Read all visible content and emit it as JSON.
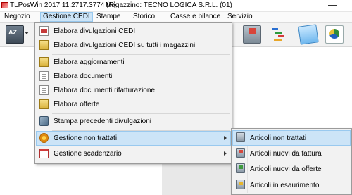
{
  "window": {
    "title": "TLPosWin 2017.11.2717.3774 (R)",
    "store": "Magazzino: TECNO LOGICA S.R.L. (01)"
  },
  "menubar": {
    "items": [
      "Negozio",
      "Gestione CEDI",
      "Stampe",
      "Storico",
      "Casse e bilance",
      "Servizio"
    ],
    "active_index": 1
  },
  "toolbar": {
    "az_label": "AZ"
  },
  "menu": {
    "items": [
      {
        "label": "Elabora divulgazioni CEDI",
        "icon": "document-red-icon"
      },
      {
        "label": "Elabora divulgazioni CEDI su tutti i magazzini",
        "icon": "document-yellow-icon"
      },
      {
        "label": "Elabora aggiornamenti",
        "icon": "document-yellow-icon"
      },
      {
        "label": "Elabora documenti",
        "icon": "document-icon"
      },
      {
        "label": "Elabora documenti rifatturazione",
        "icon": "document-icon"
      },
      {
        "label": "Elabora offerte",
        "icon": "document-yellow-icon"
      },
      {
        "label": "Stampa precedenti divulgazioni",
        "icon": "tool-icon"
      },
      {
        "label": "Gestione non trattati",
        "icon": "gear-icon",
        "has_submenu": true,
        "highlighted": true
      },
      {
        "label": "Gestione scadenzario",
        "icon": "calendar-icon",
        "has_submenu": true
      }
    ]
  },
  "submenu": {
    "items": [
      {
        "label": "Articoli non trattati",
        "icon": "cart-icon",
        "highlighted": true
      },
      {
        "label": "Articoli nuovi da fattura",
        "icon": "cart-red-icon"
      },
      {
        "label": "Articoli nuovi da offerte",
        "icon": "cart-green-icon"
      },
      {
        "label": "Articoli in esaurimento",
        "icon": "cart-yellow-icon"
      }
    ]
  },
  "colors": {
    "highlight": "#cce4f7",
    "highlight_border": "#99c9ef",
    "menu_bg": "#f2f2f2"
  }
}
